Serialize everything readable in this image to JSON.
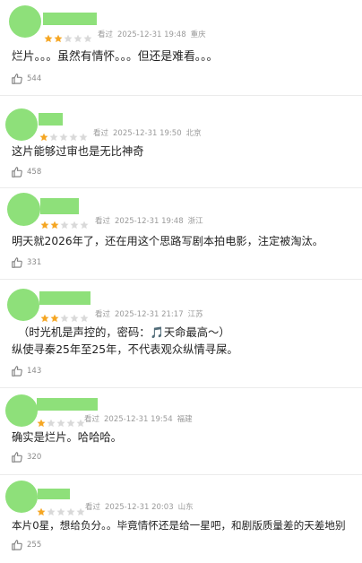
{
  "colors": {
    "avatar": "#8ee07a",
    "star_on": "#f5a623",
    "star_off": "#d9d9d9",
    "meta": "#9a9a9a"
  },
  "icons": {
    "like": "thumb-up-outline-icon",
    "star": "star-icon"
  },
  "reviews": [
    {
      "rating": 2,
      "action": "看过",
      "time": "2025-12-31 19:48",
      "location": "重庆",
      "text": [
        "烂片。。。虽然有情怀。。。但还是难看。。。"
      ],
      "likes": "544"
    },
    {
      "rating": 1,
      "action": "看过",
      "time": "2025-12-31 19:50",
      "location": "北京",
      "text": [
        "这片能够过审也是无比神奇"
      ],
      "likes": "458"
    },
    {
      "rating": 2,
      "action": "看过",
      "time": "2025-12-31 19:48",
      "location": "浙江",
      "text": [
        "明天就2026年了，还在用这个思路写剧本拍电影，注定被淘汰。"
      ],
      "likes": "331"
    },
    {
      "rating": 2,
      "action": "看过",
      "time": "2025-12-31 21:17",
      "location": "江苏",
      "text": [
        "（时光机是声控的，密码：🎵天命最高～）",
        "纵使寻秦25年至25年，不代表观众纵情寻屎。"
      ],
      "likes": "143"
    },
    {
      "rating": 1,
      "action": "看过",
      "time": "2025-12-31 19:54",
      "location": "福建",
      "text": [
        "确实是烂片。哈哈哈。"
      ],
      "likes": "320"
    },
    {
      "rating": 1,
      "action": "看过",
      "time": "2025-12-31 20:03",
      "location": "山东",
      "text": [
        "本片0星，想给负分。。毕竟情怀还是给一星吧，和剧版质量差的天差地别"
      ],
      "likes": "255"
    }
  ]
}
